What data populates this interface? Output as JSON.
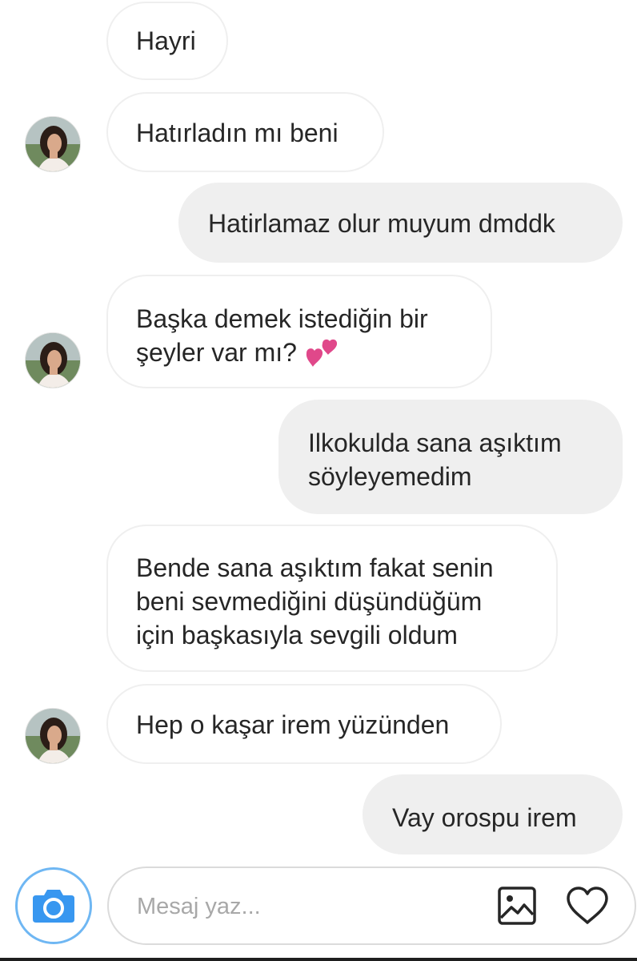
{
  "conversation": {
    "messages": [
      {
        "sender": "them",
        "text": "Hayri"
      },
      {
        "sender": "them",
        "text": "Hatırladın mı beni",
        "avatar": true
      },
      {
        "sender": "me",
        "text": "Hatirlamaz olur muyum dmddk"
      },
      {
        "sender": "them",
        "lines": [
          "Başka demek istediğin bir",
          "şeyler var mı?"
        ],
        "emoji": "two-hearts-icon",
        "avatar": true
      },
      {
        "sender": "me",
        "lines": [
          "Ilkokulda sana aşıktım",
          "söyleyemedim"
        ]
      },
      {
        "sender": "them",
        "lines": [
          "Bende sana aşıktım fakat senin",
          "beni sevmediğini düşündüğüm",
          "için başkasıyla sevgili oldum"
        ]
      },
      {
        "sender": "them",
        "text": "Hep o kaşar irem yüzünden",
        "avatar": true
      },
      {
        "sender": "me",
        "text": "Vay orospu irem"
      }
    ]
  },
  "composer": {
    "placeholder": "Mesaj yaz...",
    "icons": [
      "camera-icon",
      "image-icon",
      "heart-icon"
    ]
  },
  "colors": {
    "incoming_bubble": "#ffffff",
    "incoming_border": "#efefef",
    "outgoing_bubble": "#efefef",
    "text": "#262626",
    "placeholder": "#a8a8a8",
    "camera_accent": "#3897f0",
    "emoji_pink": "#e0488a"
  }
}
